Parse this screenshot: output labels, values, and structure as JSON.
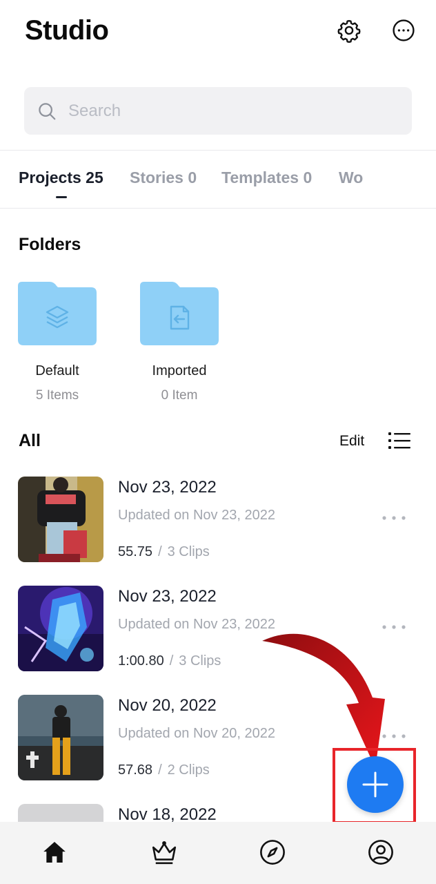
{
  "header": {
    "title": "Studio",
    "icons": [
      "gear-icon",
      "more-horizontal-circle-icon"
    ]
  },
  "search": {
    "placeholder": "Search",
    "value": ""
  },
  "tabs": [
    {
      "label": "Projects 25",
      "active": true
    },
    {
      "label": "Stories 0",
      "active": false
    },
    {
      "label": "Templates 0",
      "active": false
    },
    {
      "label": "Wo",
      "active": false
    }
  ],
  "folders": {
    "title": "Folders",
    "items": [
      {
        "name": "Default",
        "count": "5 Items",
        "icon": "layers-icon"
      },
      {
        "name": "Imported",
        "count": "0 Item",
        "icon": "import-file-icon"
      }
    ]
  },
  "all": {
    "title": "All",
    "edit_label": "Edit"
  },
  "projects": [
    {
      "title": "Nov 23, 2022",
      "updated": "Updated on Nov 23, 2022",
      "duration": "55.75",
      "separator": "/",
      "clips": "3 Clips"
    },
    {
      "title": "Nov 23, 2022",
      "updated": "Updated on Nov 23, 2022",
      "duration": "1:00.80",
      "separator": "/",
      "clips": "3 Clips"
    },
    {
      "title": "Nov 20, 2022",
      "updated": "Updated on Nov 20, 2022",
      "duration": "57.68",
      "separator": "/",
      "clips": "2 Clips"
    },
    {
      "title": "Nov 18, 2022"
    }
  ],
  "bottom_nav": [
    "home-icon",
    "crown-icon",
    "compass-icon",
    "profile-icon"
  ],
  "colors": {
    "accent": "#1e7bf2",
    "folder": "#8fd0f7",
    "annotation": "#e8252a",
    "text_primary": "#1a1f2b",
    "text_muted": "#a2a6ae"
  }
}
